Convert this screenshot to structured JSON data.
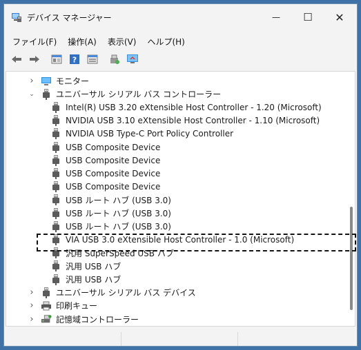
{
  "window": {
    "title": "デバイス マネージャー",
    "minimize_glyph": "—",
    "maximize_glyph": "☐",
    "close_glyph": "✕"
  },
  "menu": [
    "ファイル(F)",
    "操作(A)",
    "表示(V)",
    "ヘルプ(H)"
  ],
  "toolbar_icons": [
    "back-arrow-icon",
    "forward-arrow-icon",
    "properties-icon",
    "help-icon",
    "view-icon",
    "scan-hardware-icon",
    "monitor-icon"
  ],
  "tree": [
    {
      "level": 0,
      "expanded": false,
      "icon": "monitor-icon",
      "label": "モニター"
    },
    {
      "level": 0,
      "expanded": true,
      "icon": "usb-plug-icon",
      "label": "ユニバーサル シリアル バス コントローラー"
    },
    {
      "level": 1,
      "icon": "usb-plug-icon",
      "label": "Intel(R) USB 3.20 eXtensible Host Controller - 1.20 (Microsoft)"
    },
    {
      "level": 1,
      "icon": "usb-plug-icon",
      "label": "NVIDIA USB 3.10 eXtensible Host Controller - 1.10 (Microsoft)"
    },
    {
      "level": 1,
      "icon": "usb-plug-icon",
      "label": "NVIDIA USB Type-C Port Policy Controller"
    },
    {
      "level": 1,
      "icon": "usb-plug-icon",
      "label": "USB Composite Device"
    },
    {
      "level": 1,
      "icon": "usb-plug-icon",
      "label": "USB Composite Device"
    },
    {
      "level": 1,
      "icon": "usb-plug-icon",
      "label": "USB Composite Device"
    },
    {
      "level": 1,
      "icon": "usb-plug-icon",
      "label": "USB Composite Device"
    },
    {
      "level": 1,
      "icon": "usb-plug-icon",
      "label": "USB ルート ハブ (USB 3.0)"
    },
    {
      "level": 1,
      "icon": "usb-plug-icon",
      "label": "USB ルート ハブ (USB 3.0)"
    },
    {
      "level": 1,
      "icon": "usb-plug-icon",
      "label": "USB ルート ハブ (USB 3.0)"
    },
    {
      "level": 1,
      "icon": "usb-plug-icon",
      "label": "VIA USB 3.0 eXtensible Host Controller - 1.0 (Microsoft)",
      "selected": true
    },
    {
      "level": 1,
      "icon": "usb-plug-icon",
      "label": "汎用 SuperSpeed USB ハブ"
    },
    {
      "level": 1,
      "icon": "usb-plug-icon",
      "label": "汎用 USB ハブ"
    },
    {
      "level": 1,
      "icon": "usb-plug-icon",
      "label": "汎用 USB ハブ"
    },
    {
      "level": 0,
      "expanded": false,
      "icon": "usb-plug-icon",
      "label": "ユニバーサル シリアル バス デバイス"
    },
    {
      "level": 0,
      "expanded": false,
      "icon": "printer-icon",
      "label": "印刷キュー"
    },
    {
      "level": 0,
      "expanded": false,
      "icon": "storage-controller-icon",
      "label": "記憶域コントローラー"
    }
  ],
  "colors": {
    "desktop": "#3f73a8",
    "window_bg": "#f3f3f3",
    "monitor_blue": "#2d8fe0",
    "usb_plug": "#5b5b5b"
  }
}
